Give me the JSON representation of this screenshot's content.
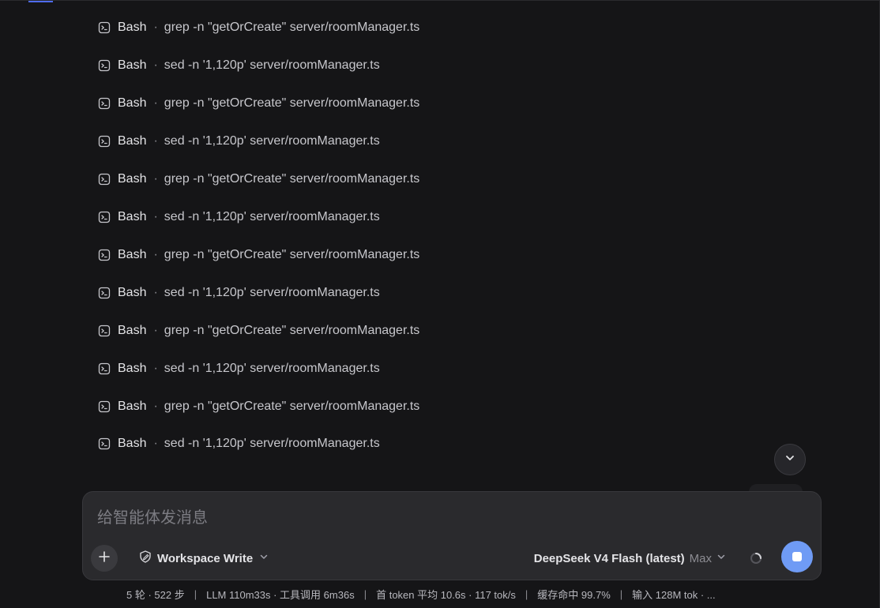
{
  "tool_calls": [
    {
      "tool": "Bash",
      "separator": "·",
      "command": "grep -n \"getOrCreate\" server/roomManager.ts"
    },
    {
      "tool": "Bash",
      "separator": "·",
      "command": "sed -n '1,120p' server/roomManager.ts"
    },
    {
      "tool": "Bash",
      "separator": "·",
      "command": "grep -n \"getOrCreate\" server/roomManager.ts"
    },
    {
      "tool": "Bash",
      "separator": "·",
      "command": "sed -n '1,120p' server/roomManager.ts"
    },
    {
      "tool": "Bash",
      "separator": "·",
      "command": "grep -n \"getOrCreate\" server/roomManager.ts"
    },
    {
      "tool": "Bash",
      "separator": "·",
      "command": "sed -n '1,120p' server/roomManager.ts"
    },
    {
      "tool": "Bash",
      "separator": "·",
      "command": "grep -n \"getOrCreate\" server/roomManager.ts"
    },
    {
      "tool": "Bash",
      "separator": "·",
      "command": "sed -n '1,120p' server/roomManager.ts"
    },
    {
      "tool": "Bash",
      "separator": "·",
      "command": "grep -n \"getOrCreate\" server/roomManager.ts"
    },
    {
      "tool": "Bash",
      "separator": "·",
      "command": "sed -n '1,120p' server/roomManager.ts"
    },
    {
      "tool": "Bash",
      "separator": "·",
      "command": "grep -n \"getOrCreate\" server/roomManager.ts"
    },
    {
      "tool": "Bash",
      "separator": "·",
      "command": "sed -n '1,120p' server/roomManager.ts"
    }
  ],
  "composer": {
    "placeholder": "给智能体发消息",
    "value": "",
    "mode_label": "Workspace Write",
    "model_label": "DeepSeek V4 Flash (latest)",
    "model_tier": "Max"
  },
  "status": {
    "separator": "|",
    "items": [
      "5 轮 · 522 步",
      "LLM 110m33s · 工具调用 6m36s",
      "首 token 平均 10.6s · 117 tok/s",
      "缓存命中 99.7%",
      "输入 128M tok · ..."
    ]
  },
  "icons": {
    "tool": "terminal-icon",
    "scroll": "chevron-down-icon",
    "add": "plus-icon",
    "mode": "shield-pen-icon",
    "dropdown": "chevron-down-icon",
    "busy": "spinner-icon",
    "stop": "stop-icon"
  },
  "colors": {
    "background": "#151517",
    "composer": "#2a2a2d",
    "accent": "#6f9bf5",
    "top_accent": "#4f6bed"
  }
}
